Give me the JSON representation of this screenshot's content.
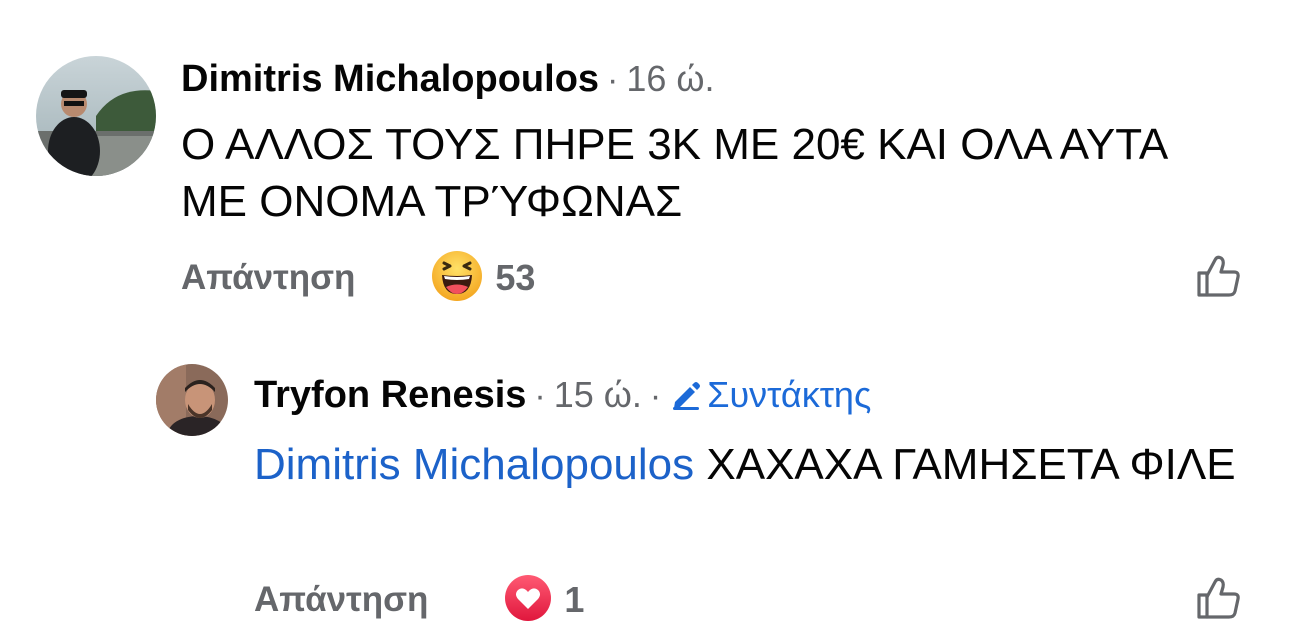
{
  "comments": [
    {
      "author": "Dimitris Michalopoulos",
      "separator": "·",
      "time": "16 ώ.",
      "text": "Ο ΑΛΛΟΣ ΤΟΥΣ ΠΗΡΕ 3Κ ΜΕ 20€ ΚΑΙ ΟΛΑ ΑΥΤΑ ΜΕ ΟΝΟΜΑ ΤΡΎΦΩΝΑΣ",
      "reply_label": "Απάντηση",
      "reaction_icon": "laughing-emoji-icon",
      "reaction_count": "53"
    },
    {
      "author": "Tryfon Renesis",
      "separator": "·",
      "time": "15 ώ.",
      "separator2": "·",
      "badge": "Συντάκτης",
      "badge_icon": "pencil-icon",
      "mention": "Dimitris Michalopoulos",
      "text": "ΧΑΧΑΧΑ ΓΑΜΗΣΕΤΑ ΦΙΛΕ",
      "reply_label": "Απάντηση",
      "reaction_icon": "love-heart-icon",
      "reaction_count": "1"
    }
  ],
  "colors": {
    "author": "#050505",
    "meta": "#65676b",
    "mention": "#1c62c9",
    "badge": "#1c6ad8",
    "love": "#f0284a",
    "haha": "#f7b125"
  },
  "icons": {
    "like_button": "thumbs-up-outline-icon"
  }
}
